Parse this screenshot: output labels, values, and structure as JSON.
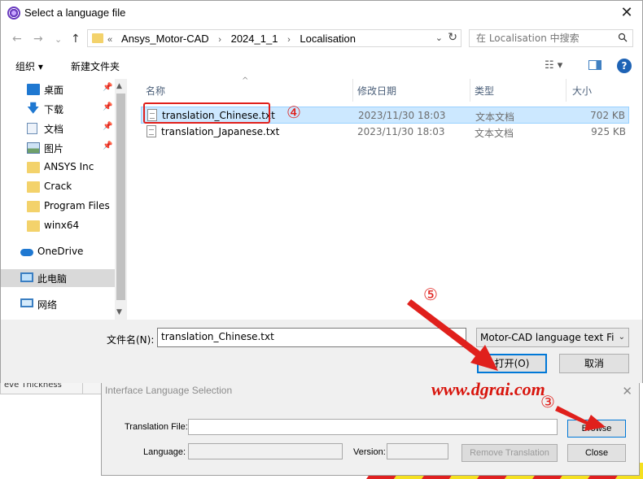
{
  "background_app": {
    "row_label": "eve Thickness",
    "stripe_colors": [
      "#e02020",
      "#f5e020",
      "#e02020",
      "#f5e020",
      "#e02020",
      "#f5e020",
      "#e02020",
      "#f5e020",
      "#e02020",
      "#f5e020"
    ]
  },
  "file_dialog": {
    "title": "Select a language file",
    "close_glyph": "✕",
    "nav": {
      "back": "←",
      "forward": "→",
      "dropdown": "⌄",
      "up": "↑"
    },
    "address": {
      "overflow": "«",
      "crumbs": [
        "Ansys_Motor-CAD",
        "2024_1_1",
        "Localisation"
      ],
      "separator": "›",
      "dropdown_glyph": "⌄",
      "refresh_glyph": "↻"
    },
    "search": {
      "placeholder": "在 Localisation 中搜索"
    },
    "toolbar": {
      "organize_label": "组织 ▾",
      "new_folder_label": "新建文件夹",
      "view_glyph": "☷ ▾",
      "help_glyph": "?"
    },
    "sidebar": {
      "items": [
        {
          "label": "桌面",
          "icon": "desktop-icon",
          "pinned": true
        },
        {
          "label": "下载",
          "icon": "download-icon",
          "pinned": true
        },
        {
          "label": "文档",
          "icon": "document-icon",
          "pinned": true
        },
        {
          "label": "图片",
          "icon": "picture-icon",
          "pinned": true
        },
        {
          "label": "ANSYS Inc",
          "icon": "folder-icon",
          "pinned": false
        },
        {
          "label": "Crack",
          "icon": "folder-icon",
          "pinned": false
        },
        {
          "label": "Program Files",
          "icon": "folder-icon",
          "pinned": false
        },
        {
          "label": "winx64",
          "icon": "folder-icon",
          "pinned": false
        },
        {
          "label": "OneDrive",
          "icon": "cloud-icon",
          "pinned": false
        },
        {
          "label": "此电脑",
          "icon": "computer-icon",
          "pinned": false,
          "selected": true
        },
        {
          "label": "网络",
          "icon": "network-icon",
          "pinned": false
        }
      ],
      "pin_glyph": "📌"
    },
    "columns": {
      "name": "名称",
      "modified": "修改日期",
      "type": "类型",
      "size": "大小"
    },
    "files": [
      {
        "name": "translation_Chinese.txt",
        "modified": "2023/11/30 18:03",
        "type": "文本文档",
        "size": "702 KB",
        "selected": true
      },
      {
        "name": "translation_Japanese.txt",
        "modified": "2023/11/30 18:03",
        "type": "文本文档",
        "size": "925 KB",
        "selected": false
      }
    ],
    "filename_label": "文件名(N):",
    "filename_value": "translation_Chinese.txt",
    "filetype_value": "Motor-CAD language text Fi",
    "open_label": "打开(O)",
    "cancel_label": "取消"
  },
  "language_dialog": {
    "title": "Interface Language Selection",
    "close_glyph": "✕",
    "translation_file_label": "Translation File:",
    "translation_file_value": "",
    "language_label": "Language:",
    "language_value": "",
    "version_label": "Version:",
    "version_value": "",
    "browse_label": "Browse",
    "remove_label": "Remove Translation",
    "close_label": "Close"
  },
  "annotations": {
    "step3": "③",
    "step4": "④",
    "step5": "⑤",
    "watermark": "www.dgrai.com",
    "color": "#e0201c"
  }
}
